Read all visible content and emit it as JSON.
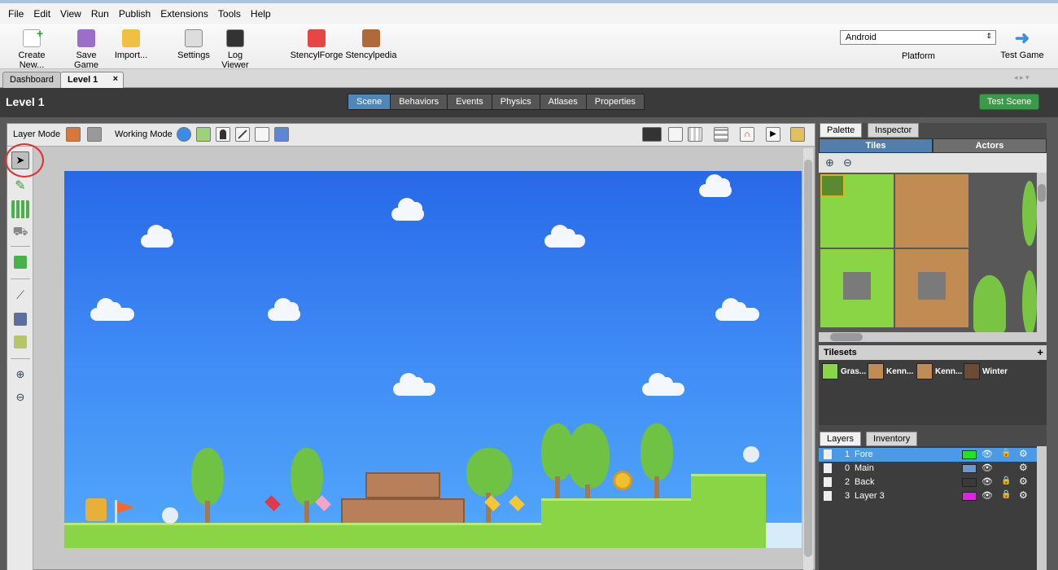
{
  "menu": [
    "File",
    "Edit",
    "View",
    "Run",
    "Publish",
    "Extensions",
    "Tools",
    "Help"
  ],
  "toolbar": {
    "create_new": "Create New...",
    "save_game": "Save Game",
    "import": "Import...",
    "settings": "Settings",
    "log_viewer": "Log Viewer",
    "stencylforge": "StencylForge",
    "stencylpedia": "Stencylpedia",
    "platform_value": "Android",
    "platform_label": "Platform",
    "test_game": "Test Game"
  },
  "tabs": {
    "dashboard": "Dashboard",
    "level": "Level 1",
    "close": "×"
  },
  "scene": {
    "title": "Level 1",
    "tabs": [
      "Scene",
      "Behaviors",
      "Events",
      "Physics",
      "Atlases",
      "Properties"
    ],
    "active_tab": "Scene",
    "test_scene": "Test Scene"
  },
  "modes": {
    "layer_mode": "Layer Mode",
    "working_mode": "Working Mode"
  },
  "palette": {
    "tab_palette": "Palette",
    "tab_inspector": "Inspector",
    "tiles": "Tiles",
    "actors": "Actors",
    "tilesets_label": "Tilesets",
    "tilesets": [
      "Gras...",
      "Kenn...",
      "Kenn...",
      "Winter"
    ]
  },
  "layers_panel": {
    "tab_layers": "Layers",
    "tab_inventory": "Inventory",
    "layers": [
      {
        "num": "1",
        "name": "Fore",
        "color": "#22e322",
        "locked": true,
        "selected": true
      },
      {
        "num": "0",
        "name": "Main",
        "color": "#6a9ad4",
        "locked": false,
        "selected": false
      },
      {
        "num": "2",
        "name": "Back",
        "color": "#3a3a3a",
        "locked": true,
        "selected": false
      },
      {
        "num": "3",
        "name": "Layer 3",
        "color": "#e51ee5",
        "locked": true,
        "selected": false
      }
    ]
  }
}
